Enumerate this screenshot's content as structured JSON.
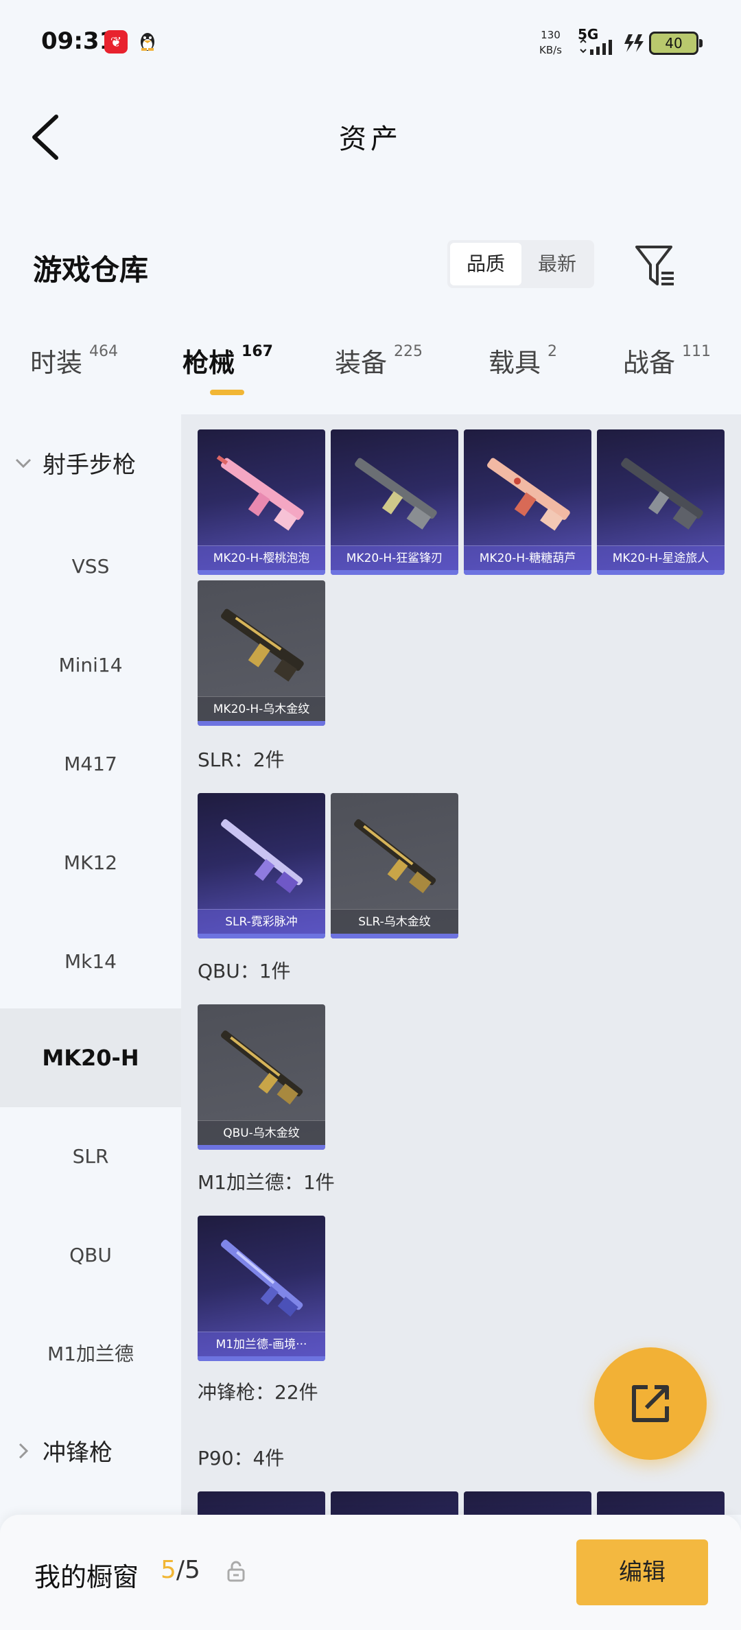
{
  "status_bar": {
    "time": "09:31",
    "app_badge": "❦",
    "net_speed_value": "130",
    "net_speed_unit": "KB/s",
    "network": "5G",
    "battery": "40"
  },
  "header": {
    "title": "资产"
  },
  "warehouse": {
    "title": "游戏仓库",
    "sort_options": [
      "品质",
      "最新"
    ],
    "active_sort": "品质"
  },
  "tabs": [
    {
      "label": "时装",
      "count": "464"
    },
    {
      "label": "枪械",
      "count": "167",
      "active": true
    },
    {
      "label": "装备",
      "count": "225"
    },
    {
      "label": "载具",
      "count": "2"
    },
    {
      "label": "战备",
      "count": "111"
    }
  ],
  "sidebar": {
    "group_expanded": "射手步枪",
    "items": [
      "VSS",
      "Mini14",
      "M417",
      "MK12",
      "Mk14",
      "MK20-H",
      "SLR",
      "QBU",
      "M1加兰德"
    ],
    "active_item": "MK20-H",
    "group_collapsed": "冲锋枪"
  },
  "content": {
    "mk20_items": [
      "MK20-H-樱桃泡泡",
      "MK20-H-狂鲨锋刃",
      "MK20-H-糖糖葫芦",
      "MK20-H-星途旅人",
      "MK20-H-乌木金纹"
    ],
    "slr_title": "SLR：2件",
    "slr_items": [
      "SLR-霓彩脉冲",
      "SLR-乌木金纹"
    ],
    "qbu_title": "QBU：1件",
    "qbu_items": [
      "QBU-乌木金纹"
    ],
    "m1_title": "M1加兰德：1件",
    "m1_items": [
      "M1加兰德-画境···"
    ],
    "smg_title": "冲锋枪：22件",
    "p90_title": "P90：4件"
  },
  "bottom": {
    "showcase_label": "我的橱窗",
    "showcase_current": "5",
    "showcase_sep": "/",
    "showcase_total": "5",
    "edit_label": "编辑"
  },
  "colors": {
    "accent": "#f1b635",
    "card_purple": "#2d2a63",
    "card_grey": "#5b5d66",
    "rarity_bar": "#6d73e0"
  }
}
